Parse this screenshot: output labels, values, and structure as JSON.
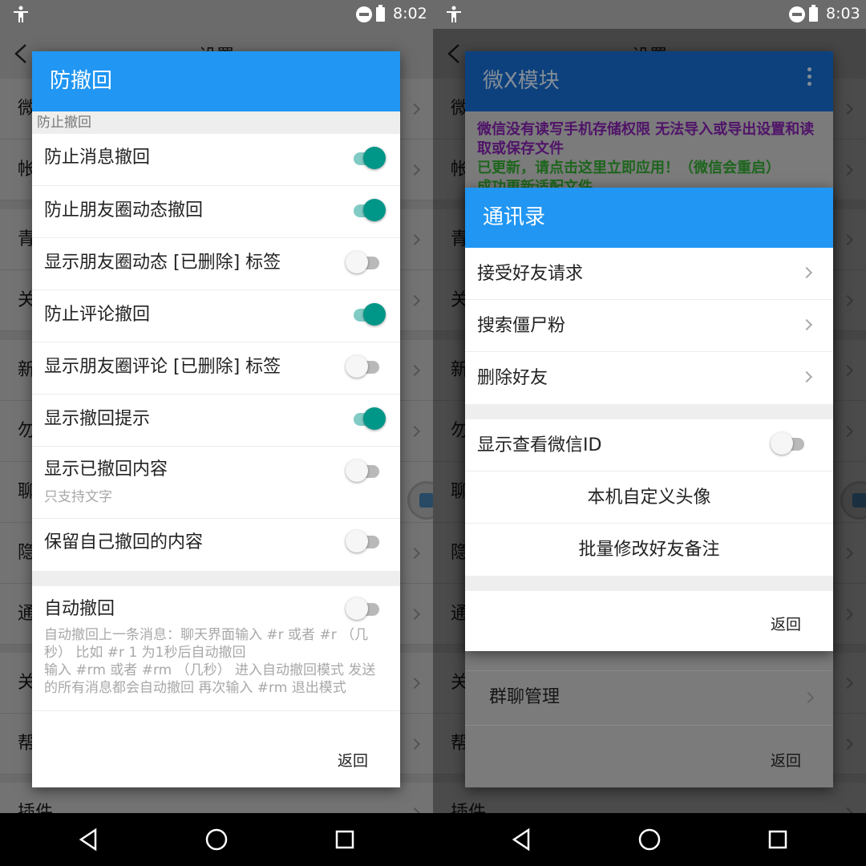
{
  "status": {
    "left_time": "8:02",
    "right_time": "8:03"
  },
  "background": {
    "title": "设置",
    "left_initials": [
      "微",
      "帐",
      "青",
      "关",
      "新",
      "勿",
      "聊",
      "隐",
      "通",
      "关",
      "帮",
      "插件"
    ],
    "right_initials": [
      "微",
      "帐",
      "青",
      "关",
      "新",
      "勿",
      "聊",
      "隐",
      "通",
      "关",
      "帮",
      "插件"
    ]
  },
  "left_dialog": {
    "title": "防撤回",
    "section": "防止撤回",
    "prefs": [
      {
        "title": "防止消息撤回",
        "on": true
      },
      {
        "title": "防止朋友圈动态撤回",
        "on": true
      },
      {
        "title": "显示朋友圈动态 [已删除] 标签",
        "on": false
      },
      {
        "title": "防止评论撤回",
        "on": true
      },
      {
        "title": "显示朋友圈评论 [已删除] 标签",
        "on": false
      },
      {
        "title": "显示撤回提示",
        "on": true
      },
      {
        "title": "显示已撤回内容",
        "summary": "只支持文字",
        "on": false
      },
      {
        "title": "保留自己撤回的内容",
        "on": false
      }
    ],
    "auto": {
      "title": "自动撤回",
      "summary": "自动撤回上一条消息：聊天界面输入 #r 或者 #r （几秒） 比如 #r 1 为1秒后自动撤回\n输入 #rm 或者 #rm （几秒） 进入自动撤回模式 发送的所有消息都会自动撤回 再次输入 #rm 退出模式",
      "on": false
    },
    "back": "返回"
  },
  "right_module": {
    "title": "微X模块",
    "msg_purple": "微信没有读写手机存储权限 无法导入或导出设置和读取或保存文件",
    "msg_green": "已更新，请点击这里立即应用！（微信会重启）",
    "msg_green2": "成功更新适配文件",
    "row_group": "群聊管理",
    "back": "返回",
    "colors": {
      "purple": "#7b1fa2",
      "green": "#2e9b2e"
    }
  },
  "contacts_dialog": {
    "title": "通讯录",
    "rows": [
      "接受好友请求",
      "搜索僵尸粉",
      "删除好友"
    ],
    "show_wxid": "显示查看微信ID",
    "show_wxid_on": false,
    "actions": [
      "本机自定义头像",
      "批量修改好友备注"
    ],
    "back": "返回"
  },
  "colors": {
    "accent": "#2196f3",
    "toggle_on": "#009688"
  }
}
